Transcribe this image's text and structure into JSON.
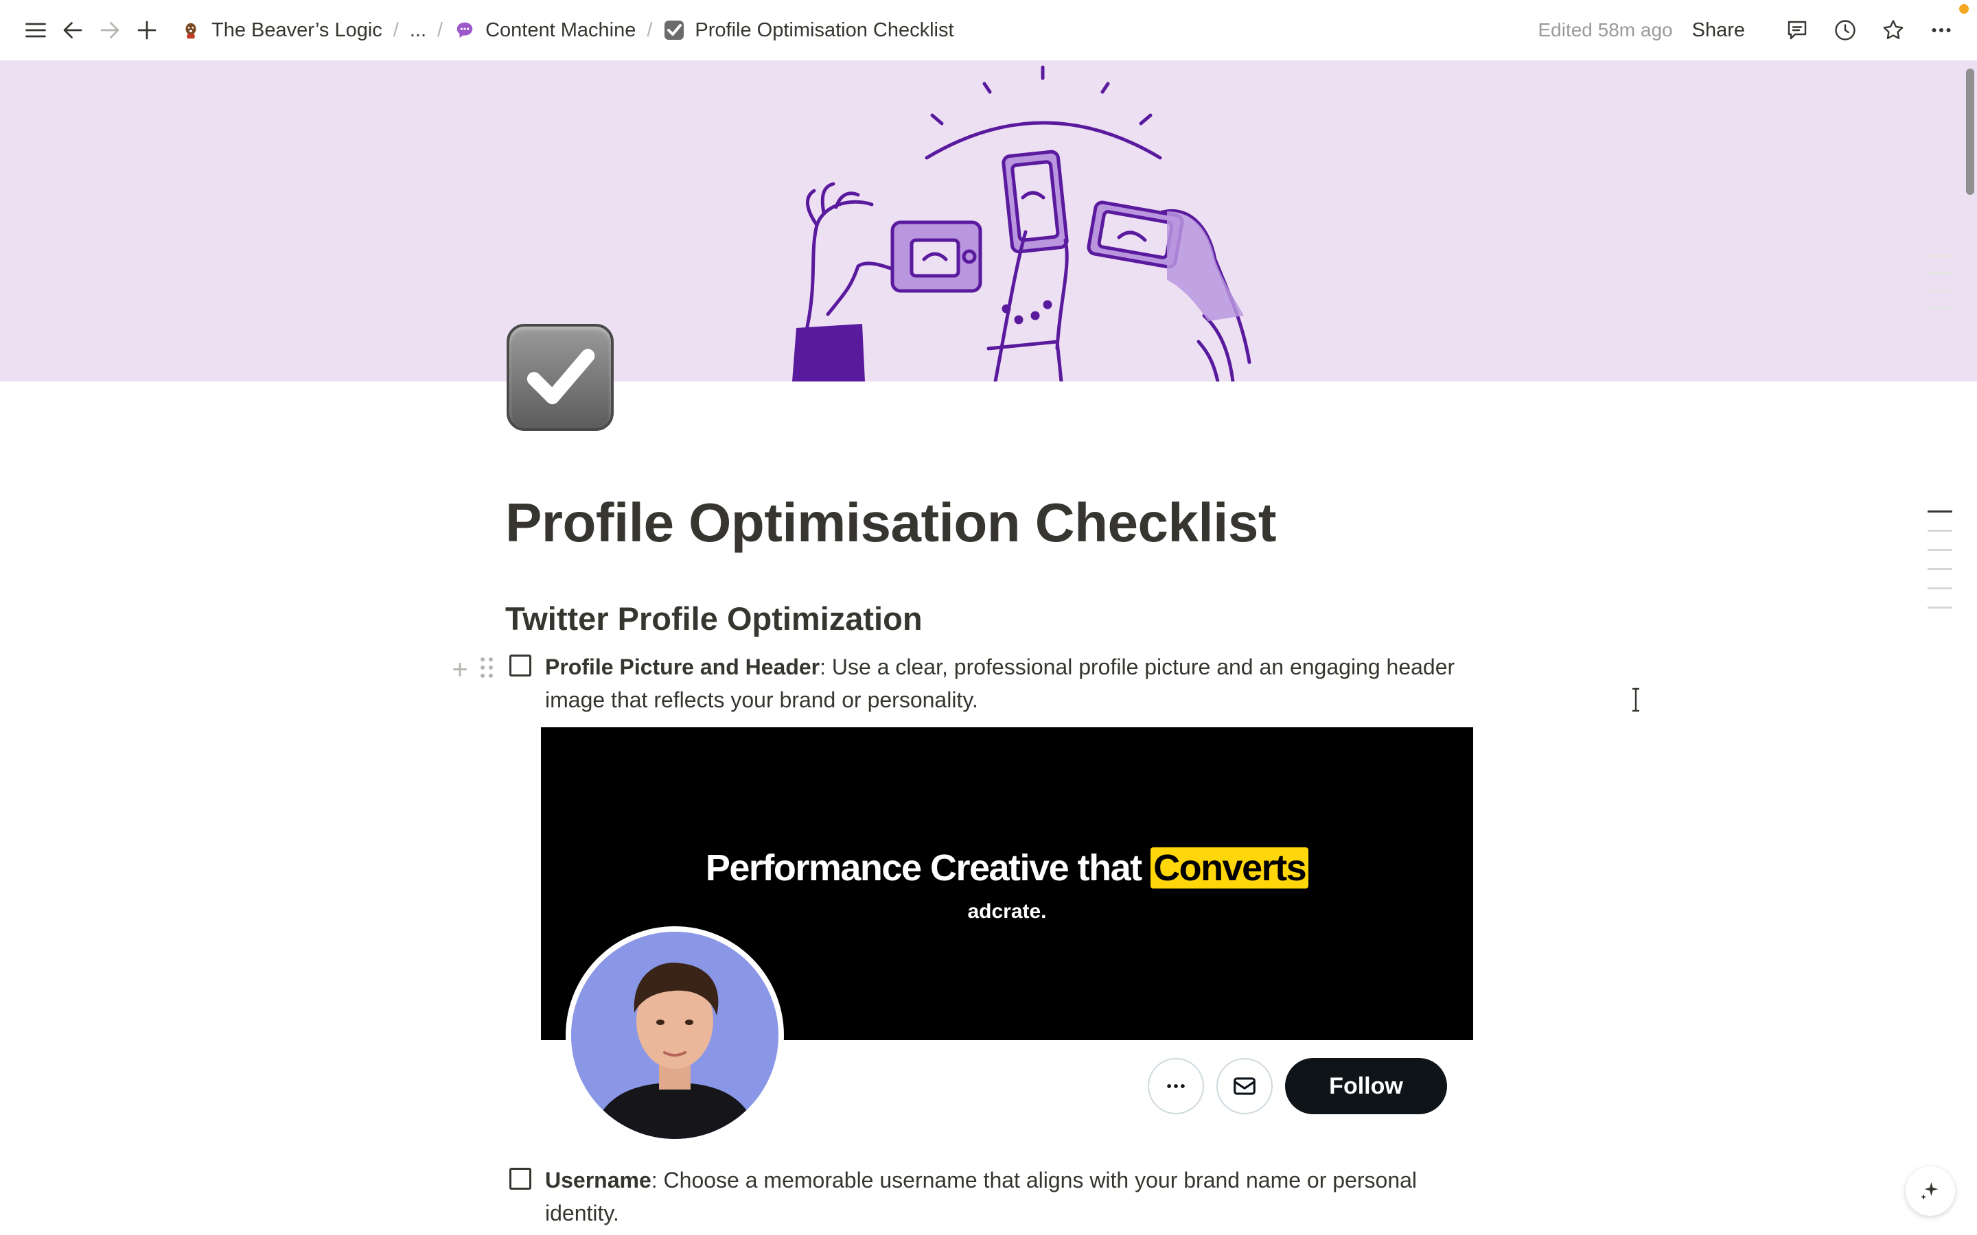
{
  "topbar": {
    "breadcrumbs": [
      {
        "label": "The Beaver’s Logic",
        "icon": "beaver-icon"
      },
      {
        "label": "...",
        "icon": ""
      },
      {
        "label": "Content Machine",
        "icon": "speech-bubble-icon"
      },
      {
        "label": "Profile Optimisation Checklist",
        "icon": "checkbox-icon"
      }
    ],
    "edited": "Edited 58m ago",
    "share": "Share"
  },
  "page": {
    "title": "Profile Optimisation Checklist",
    "heading": "Twitter Profile Optimization",
    "todos": [
      {
        "bold": "Profile Picture and Header",
        "text": ": Use a clear, professional profile picture and an engaging header image that reflects your brand or personality.",
        "checked": false
      },
      {
        "bold": "Username",
        "text": ": Choose a memorable username that aligns with your brand name or personal identity.",
        "checked": false
      }
    ]
  },
  "embed": {
    "headline_pre": "Performance Creative that ",
    "headline_highlight": "Converts",
    "subtext": "adcrate.",
    "follow_label": "Follow",
    "highlight_color": "#ffd60a"
  },
  "colors": {
    "cover_bg": "#ede0f3",
    "accent_purple": "#5a1a9e",
    "text": "#37352f"
  }
}
